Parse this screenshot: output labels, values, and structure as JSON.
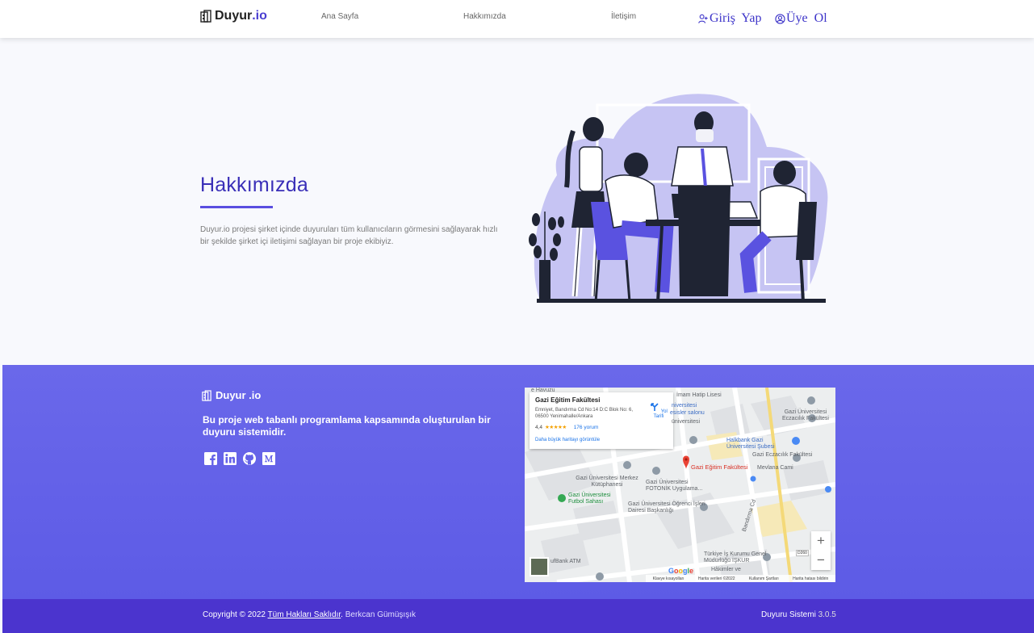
{
  "nav": {
    "brand_main": "Duyur",
    "brand_suffix": ".io",
    "links": [
      "Ana Sayfa",
      "Hakkımızda",
      "İletişim"
    ],
    "login": "Giriş Yap",
    "register": "Üye Ol"
  },
  "hero": {
    "title": "Hakkımızda",
    "text": "Duyur.io projesi şirket içinde duyuruları tüm kullanıcıların görmesini sağlayarak hızlı bir şekilde şirket içi iletişimi sağlayan bir proje ekibiyiz."
  },
  "footer": {
    "brand": "Duyur .io",
    "description": "Bu proje web tabanlı programlama kapsamında oluşturulan bir duyuru sistemidir.",
    "socials": [
      "facebook-icon",
      "linkedin-icon",
      "github-icon",
      "medium-icon"
    ],
    "copyright_prefix": "Copyright © 2022",
    "copyright_link": "Tüm Hakları Saklıdır",
    "copyright_author": "Berkcan Gümüşışık",
    "version_label": "Duyuru Sistemi",
    "version_number": "3.0.5"
  },
  "map": {
    "place_title": "Gazi Eğitim Fakültesi",
    "address": "Emniyet, Bandırma Cd No:14 D:C Blok No: 6, 06500 Yenimahalle/Ankara",
    "rating": "4,4",
    "stars": "★★★★★",
    "reviews": "176 yorum",
    "larger_map": "Daha büyük haritayı görüntüle",
    "directions": "Yol Tarifi",
    "labels": {
      "top_left": "e Havuzu",
      "imam": "İmam Hatip Lisesi",
      "salonu": "esisler salonu",
      "univ1": "üniversitesi",
      "univ2": "niversitesi",
      "eczaci1": "Gazi Üniversitesi Eczacılık Fakültesi",
      "halkbank": "Halkbank Gazi Üniversitesi Şubesi",
      "eczaci2": "Gazi Eczacılık Fakültesi",
      "pin": "Gazi Eğitim Fakültesi",
      "mevlana": "Mevlana Cami",
      "kutuphane": "Gazi Üniversitesi Merkez Kütüphanesi",
      "fotonik": "Gazi Üniversitesi FOTONİK Uygulama...",
      "futbol": "Gazi Üniversitesi Futbol Sahası",
      "ogrenci": "Gazi Üniversitesi Öğrenci İşleri Dairesi Başkanlığı",
      "bandirma": "Bandırma Cd",
      "iskur": "Türkiye İş Kurumu Genel Müdürlüğü İŞKUR",
      "hakimler": "Hâkimler ve",
      "atm": "ufBank ATM",
      "road": "D260"
    },
    "google": "Google",
    "attribution": [
      "Klavye kısayolları",
      "Harita verileri ©2022",
      "Kullanım Şartları",
      "Harita hatası bildirin"
    ],
    "zoom_in": "+",
    "zoom_out": "−"
  },
  "colors": {
    "accent": "#4a3fd1",
    "footer": "#6462e8",
    "footer_bottom": "#4b34ce",
    "illustration_bg": "#c6c4f3"
  }
}
